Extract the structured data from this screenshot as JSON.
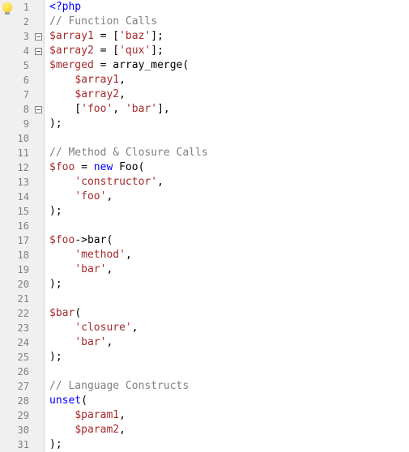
{
  "editor": {
    "lines": [
      {
        "n": 1,
        "marker": "bulb",
        "fold": null,
        "tokens": [
          [
            "keyword",
            "<?php"
          ]
        ]
      },
      {
        "n": 2,
        "marker": null,
        "fold": null,
        "tokens": [
          [
            "comment",
            "// Function Calls"
          ]
        ]
      },
      {
        "n": 3,
        "marker": null,
        "fold": "minus",
        "tokens": [
          [
            "var",
            "$array1"
          ],
          [
            "default",
            " = ["
          ],
          [
            "string",
            "'baz'"
          ],
          [
            "default",
            "];"
          ]
        ]
      },
      {
        "n": 4,
        "marker": null,
        "fold": "minus",
        "tokens": [
          [
            "var",
            "$array2"
          ],
          [
            "default",
            " = ["
          ],
          [
            "string",
            "'qux'"
          ],
          [
            "default",
            "];"
          ]
        ]
      },
      {
        "n": 5,
        "marker": null,
        "fold": null,
        "tokens": [
          [
            "var",
            "$merged"
          ],
          [
            "default",
            " = "
          ],
          [
            "func",
            "array_merge"
          ],
          [
            "default",
            "("
          ]
        ]
      },
      {
        "n": 6,
        "marker": null,
        "fold": null,
        "tokens": [
          [
            "default",
            "    "
          ],
          [
            "var",
            "$array1"
          ],
          [
            "default",
            ","
          ]
        ]
      },
      {
        "n": 7,
        "marker": null,
        "fold": null,
        "tokens": [
          [
            "default",
            "    "
          ],
          [
            "var",
            "$array2"
          ],
          [
            "default",
            ","
          ]
        ]
      },
      {
        "n": 8,
        "marker": null,
        "fold": "minus",
        "tokens": [
          [
            "default",
            "    ["
          ],
          [
            "string",
            "'foo'"
          ],
          [
            "default",
            ", "
          ],
          [
            "string",
            "'bar'"
          ],
          [
            "default",
            "],"
          ]
        ]
      },
      {
        "n": 9,
        "marker": null,
        "fold": null,
        "tokens": [
          [
            "default",
            ");"
          ]
        ]
      },
      {
        "n": 10,
        "marker": null,
        "fold": null,
        "tokens": [
          [
            "default",
            ""
          ]
        ]
      },
      {
        "n": 11,
        "marker": null,
        "fold": null,
        "tokens": [
          [
            "comment",
            "// Method & Closure Calls"
          ]
        ]
      },
      {
        "n": 12,
        "marker": null,
        "fold": null,
        "tokens": [
          [
            "var",
            "$foo"
          ],
          [
            "default",
            " = "
          ],
          [
            "new",
            "new"
          ],
          [
            "default",
            " "
          ],
          [
            "class",
            "Foo"
          ],
          [
            "default",
            "("
          ]
        ]
      },
      {
        "n": 13,
        "marker": null,
        "fold": null,
        "tokens": [
          [
            "default",
            "    "
          ],
          [
            "string",
            "'constructor'"
          ],
          [
            "default",
            ","
          ]
        ]
      },
      {
        "n": 14,
        "marker": null,
        "fold": null,
        "tokens": [
          [
            "default",
            "    "
          ],
          [
            "string",
            "'foo'"
          ],
          [
            "default",
            ","
          ]
        ]
      },
      {
        "n": 15,
        "marker": null,
        "fold": null,
        "tokens": [
          [
            "default",
            ");"
          ]
        ]
      },
      {
        "n": 16,
        "marker": null,
        "fold": null,
        "tokens": [
          [
            "default",
            ""
          ]
        ]
      },
      {
        "n": 17,
        "marker": null,
        "fold": null,
        "tokens": [
          [
            "var",
            "$foo"
          ],
          [
            "arrow",
            "->"
          ],
          [
            "func",
            "bar"
          ],
          [
            "default",
            "("
          ]
        ]
      },
      {
        "n": 18,
        "marker": null,
        "fold": null,
        "tokens": [
          [
            "default",
            "    "
          ],
          [
            "string",
            "'method'"
          ],
          [
            "default",
            ","
          ]
        ]
      },
      {
        "n": 19,
        "marker": null,
        "fold": null,
        "tokens": [
          [
            "default",
            "    "
          ],
          [
            "string",
            "'bar'"
          ],
          [
            "default",
            ","
          ]
        ]
      },
      {
        "n": 20,
        "marker": null,
        "fold": null,
        "tokens": [
          [
            "default",
            ");"
          ]
        ]
      },
      {
        "n": 21,
        "marker": null,
        "fold": null,
        "tokens": [
          [
            "default",
            ""
          ]
        ]
      },
      {
        "n": 22,
        "marker": null,
        "fold": null,
        "tokens": [
          [
            "var",
            "$bar"
          ],
          [
            "default",
            "("
          ]
        ]
      },
      {
        "n": 23,
        "marker": null,
        "fold": null,
        "tokens": [
          [
            "default",
            "    "
          ],
          [
            "string",
            "'closure'"
          ],
          [
            "default",
            ","
          ]
        ]
      },
      {
        "n": 24,
        "marker": null,
        "fold": null,
        "tokens": [
          [
            "default",
            "    "
          ],
          [
            "string",
            "'bar'"
          ],
          [
            "default",
            ","
          ]
        ]
      },
      {
        "n": 25,
        "marker": null,
        "fold": null,
        "tokens": [
          [
            "default",
            ");"
          ]
        ]
      },
      {
        "n": 26,
        "marker": null,
        "fold": null,
        "tokens": [
          [
            "default",
            ""
          ]
        ]
      },
      {
        "n": 27,
        "marker": null,
        "fold": null,
        "tokens": [
          [
            "comment",
            "// Language Constructs"
          ]
        ]
      },
      {
        "n": 28,
        "marker": null,
        "fold": null,
        "tokens": [
          [
            "keyword",
            "unset"
          ],
          [
            "default",
            "("
          ]
        ]
      },
      {
        "n": 29,
        "marker": null,
        "fold": null,
        "tokens": [
          [
            "default",
            "    "
          ],
          [
            "var",
            "$param1"
          ],
          [
            "default",
            ","
          ]
        ]
      },
      {
        "n": 30,
        "marker": null,
        "fold": null,
        "tokens": [
          [
            "default",
            "    "
          ],
          [
            "var",
            "$param2"
          ],
          [
            "default",
            ","
          ]
        ]
      },
      {
        "n": 31,
        "marker": null,
        "fold": null,
        "tokens": [
          [
            "default",
            ");"
          ]
        ]
      }
    ]
  }
}
